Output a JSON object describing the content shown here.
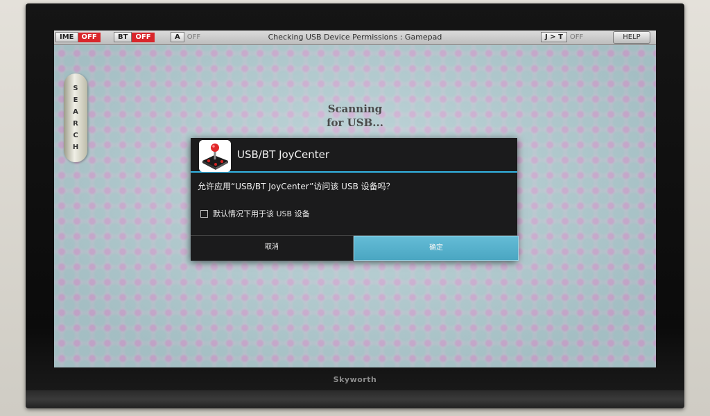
{
  "tv": {
    "brand": "Skyworth"
  },
  "status_bar": {
    "ime_label": "IME",
    "ime_state": "OFF",
    "bt_label": "BT",
    "bt_state": "OFF",
    "a_label": "A",
    "a_state": "OFF",
    "message": "Checking USB Device Permissions : Gamepad",
    "jt_label": "J > T",
    "jt_state": "OFF",
    "help_label": "HELP",
    "colors": {
      "off_red": "#d9262b",
      "accent": "#33b5e5"
    }
  },
  "search_tab": {
    "letters": [
      "S",
      "E",
      "A",
      "R",
      "C",
      "H"
    ]
  },
  "scanning": {
    "line1": "Scanning",
    "line2": "for USB..."
  },
  "dialog": {
    "app_icon": "joystick-icon",
    "title": "USB/BT JoyCenter",
    "message": "允许应用“USB/BT JoyCenter”访问该 USB 设备吗？",
    "checkbox_label": "默认情况下用于该 USB 设备",
    "checkbox_checked": false,
    "cancel_label": "取消",
    "ok_label": "确定"
  }
}
